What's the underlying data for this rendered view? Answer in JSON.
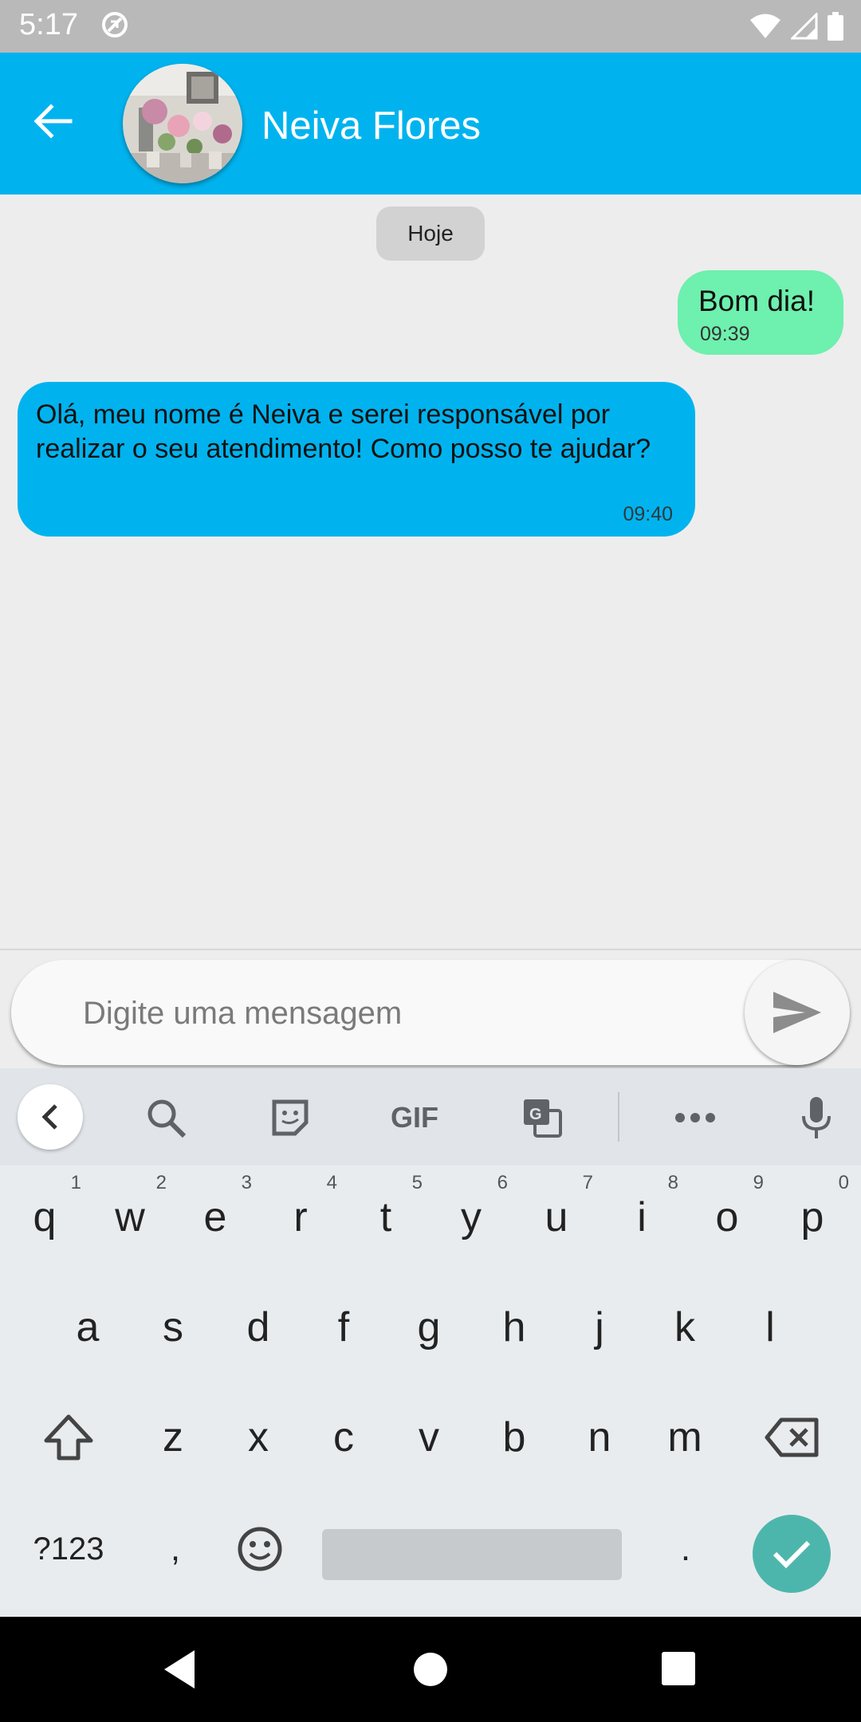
{
  "status_bar": {
    "time": "5:17"
  },
  "header": {
    "contact_name": "Neiva Flores"
  },
  "chat": {
    "date_chip": "Hoje",
    "messages": [
      {
        "direction": "outgoing",
        "text": "Bom dia!",
        "time": "09:39"
      },
      {
        "direction": "incoming",
        "text": "Olá, meu nome é Neiva e serei responsável por realizar o seu atendimento! Como posso te ajudar?",
        "time": "09:40"
      }
    ]
  },
  "composer": {
    "placeholder": "Digite uma mensagem",
    "value": ""
  },
  "keyboard": {
    "toolbar": [
      "collapse",
      "search",
      "sticker",
      "GIF",
      "translate",
      "more",
      "mic"
    ],
    "gif_label": "GIF",
    "row1": [
      {
        "k": "q",
        "n": "1"
      },
      {
        "k": "w",
        "n": "2"
      },
      {
        "k": "e",
        "n": "3"
      },
      {
        "k": "r",
        "n": "4"
      },
      {
        "k": "t",
        "n": "5"
      },
      {
        "k": "y",
        "n": "6"
      },
      {
        "k": "u",
        "n": "7"
      },
      {
        "k": "i",
        "n": "8"
      },
      {
        "k": "o",
        "n": "9"
      },
      {
        "k": "p",
        "n": "0"
      }
    ],
    "row2": [
      "a",
      "s",
      "d",
      "f",
      "g",
      "h",
      "j",
      "k",
      "l"
    ],
    "row3": [
      "z",
      "x",
      "c",
      "v",
      "b",
      "n",
      "m"
    ],
    "symbols_key": "?123",
    "comma_key": ",",
    "period_key": "."
  },
  "colors": {
    "app_bar": "#00b3ee",
    "incoming_bubble": "#00b3ee",
    "outgoing_bubble": "#6ef0ae",
    "enter_key": "#4db6ac"
  }
}
